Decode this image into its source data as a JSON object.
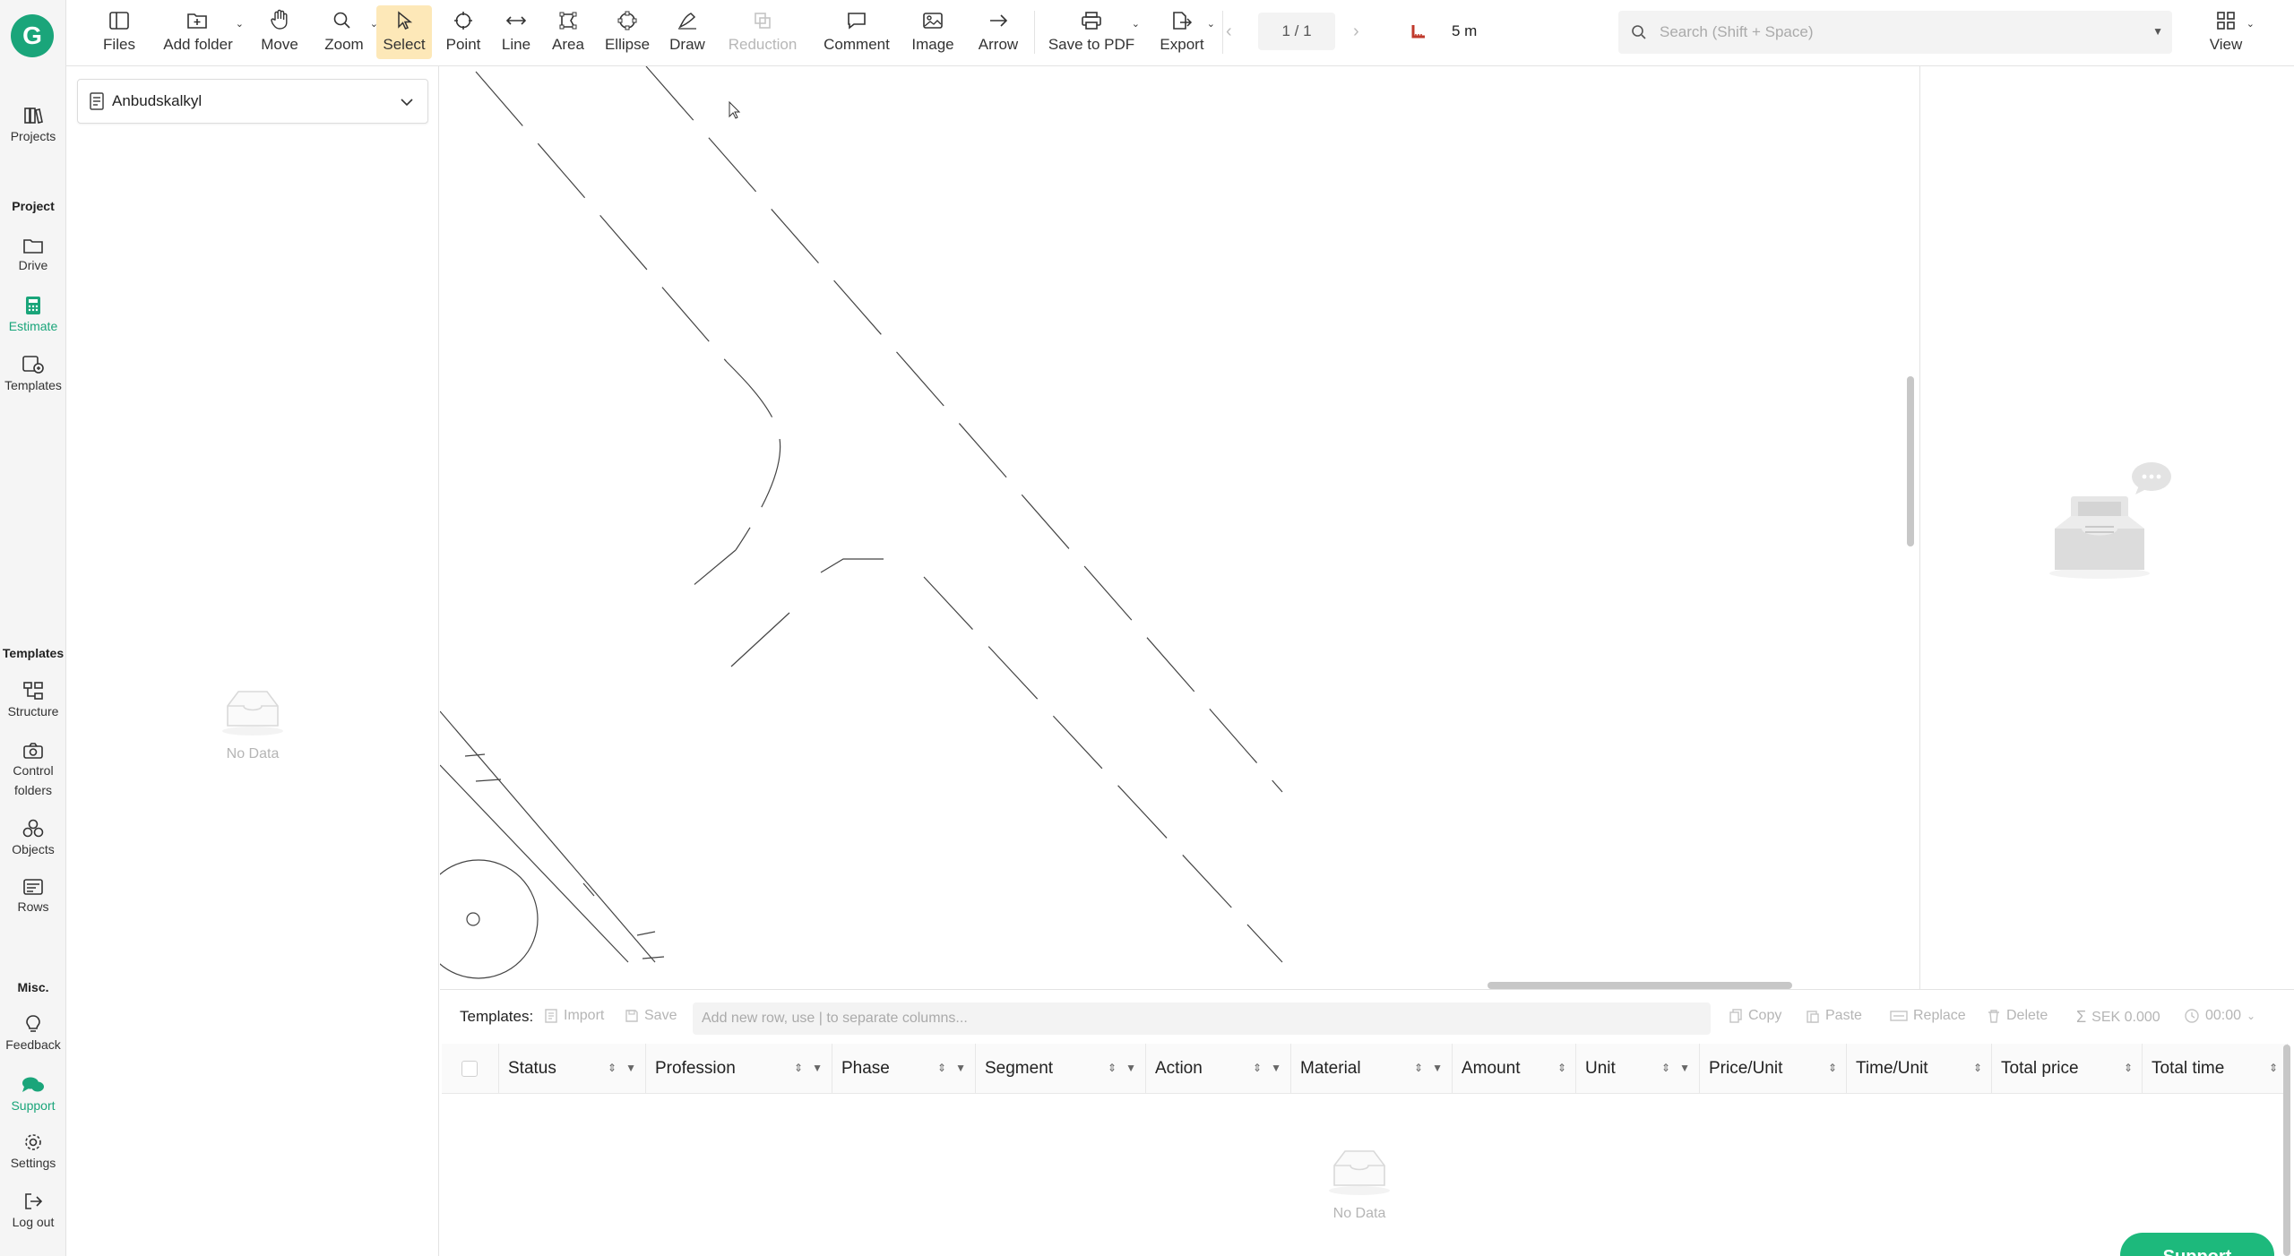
{
  "rail": {
    "logo": "G",
    "projects": "Projects",
    "project_header": "Project",
    "drive": "Drive",
    "estimate": "Estimate",
    "templates_item": "Templates",
    "templates_header": "Templates",
    "structure": "Structure",
    "control_folders_1": "Control",
    "control_folders_2": "folders",
    "objects": "Objects",
    "rows": "Rows",
    "misc_header": "Misc.",
    "feedback": "Feedback",
    "support": "Support",
    "settings": "Settings",
    "logout": "Log out"
  },
  "toolbar": {
    "files": "Files",
    "add_folder": "Add folder",
    "move": "Move",
    "zoom": "Zoom",
    "select": "Select",
    "point": "Point",
    "line": "Line",
    "area": "Area",
    "ellipse": "Ellipse",
    "draw": "Draw",
    "reduction": "Reduction",
    "comment": "Comment",
    "image": "Image",
    "arrow": "Arrow",
    "save_pdf": "Save to PDF",
    "export": "Export",
    "page": "1 / 1",
    "scale": "5 m",
    "search_placeholder": "Search (Shift + Space)",
    "view": "View"
  },
  "left_panel": {
    "select_value": "Anbudskalkyl",
    "no_data": "No Data"
  },
  "bottom": {
    "templates_label": "Templates:",
    "import": "Import",
    "save": "Save",
    "new_row_placeholder": "Add new row, use | to separate columns...",
    "copy": "Copy",
    "paste": "Paste",
    "replace": "Replace",
    "delete": "Delete",
    "sum": "SEK 0.000",
    "time": "00:00",
    "columns": [
      "Status",
      "Profession",
      "Phase",
      "Segment",
      "Action",
      "Material",
      "Amount",
      "Unit",
      "Price/Unit",
      "Time/Unit",
      "Total price",
      "Total time"
    ],
    "no_data": "No Data",
    "support_button": "Support"
  },
  "colors": {
    "accent": "#1aa57a",
    "select_highlight": "#fde8b8"
  }
}
